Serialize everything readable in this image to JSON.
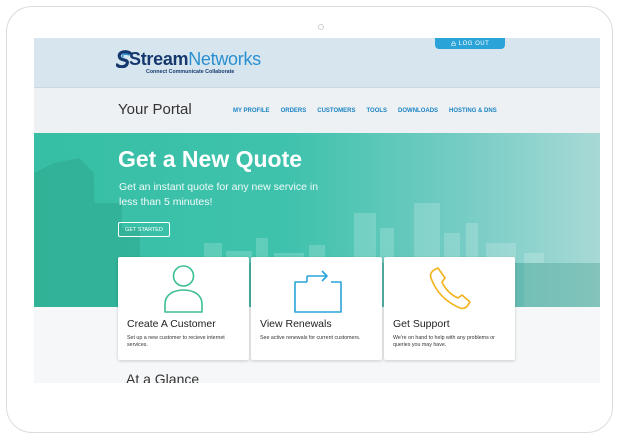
{
  "header": {
    "logout_label": "LOG OUT",
    "logo_name_first": "Stream",
    "logo_name_second": "Networks",
    "logo_tagline": "Connect Communicate Collaborate"
  },
  "nav": {
    "portal_title": "Your Portal",
    "items": [
      "MY PROFILE",
      "ORDERS",
      "CUSTOMERS",
      "TOOLS",
      "DOWNLOADS",
      "HOSTING & DNS"
    ]
  },
  "hero": {
    "title": "Get a New Quote",
    "subtitle": "Get an instant quote for any new service in less than 5 minutes!",
    "button_label": "GET STARTED"
  },
  "cards": [
    {
      "title": "Create A Customer",
      "description": "Set up a new customer to recieve internet services.",
      "icon": "person-icon",
      "color": "#3cbf8f"
    },
    {
      "title": "View Renewals",
      "description": "See active renewals for current customers.",
      "icon": "renew-arrows-icon",
      "color": "#2aa4d8"
    },
    {
      "title": "Get Support",
      "description": "We're on hand to help with any problems or queries you may have.",
      "icon": "phone-icon",
      "color": "#f2b31c"
    }
  ],
  "glance_heading": "At a Glance",
  "colors": {
    "brand_dark": "#15396e",
    "brand_blue": "#2a8fd0",
    "accent_teal": "#36bfa4",
    "logout_blue": "#2aa4d8"
  }
}
